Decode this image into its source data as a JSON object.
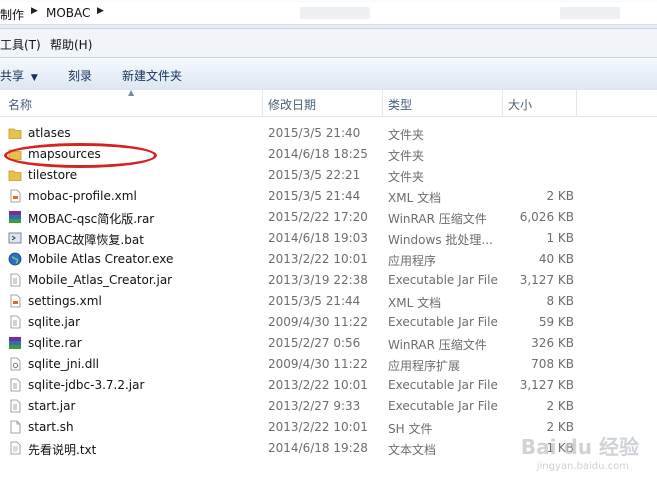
{
  "address": {
    "crumbs": [
      "制作",
      "MOBAC"
    ]
  },
  "menu": [
    "工具(T)",
    "帮助(H)"
  ],
  "toolbar": {
    "share": "共享",
    "burn": "刻录",
    "new_folder": "新建文件夹"
  },
  "columns": {
    "name": "名称",
    "modified": "修改日期",
    "type": "类型",
    "size": "大小"
  },
  "files": [
    {
      "name": "atlases",
      "date": "2015/3/5 21:40",
      "type": "文件夹",
      "size": "",
      "icon": "folder-icon"
    },
    {
      "name": "mapsources",
      "date": "2014/6/18 18:25",
      "type": "文件夹",
      "size": "",
      "icon": "folder-icon"
    },
    {
      "name": "tilestore",
      "date": "2015/3/5 22:21",
      "type": "文件夹",
      "size": "",
      "icon": "folder-icon"
    },
    {
      "name": "mobac-profile.xml",
      "date": "2015/3/5 21:44",
      "type": "XML 文档",
      "size": "2 KB",
      "icon": "xml-file-icon"
    },
    {
      "name": "MOBAC-qsc简化版.rar",
      "date": "2015/2/22 17:20",
      "type": "WinRAR 压缩文件",
      "size": "6,026 KB",
      "icon": "rar-file-icon"
    },
    {
      "name": "MOBAC故障恢复.bat",
      "date": "2014/6/18 19:03",
      "type": "Windows 批处理...",
      "size": "1 KB",
      "icon": "bat-file-icon"
    },
    {
      "name": "Mobile Atlas Creator.exe",
      "date": "2013/2/22 10:01",
      "type": "应用程序",
      "size": "40 KB",
      "icon": "globe-exe-icon"
    },
    {
      "name": "Mobile_Atlas_Creator.jar",
      "date": "2013/3/19 22:38",
      "type": "Executable Jar File",
      "size": "3,127 KB",
      "icon": "jar-file-icon"
    },
    {
      "name": "settings.xml",
      "date": "2015/3/5 21:44",
      "type": "XML 文档",
      "size": "8 KB",
      "icon": "xml-file-icon"
    },
    {
      "name": "sqlite.jar",
      "date": "2009/4/30 11:22",
      "type": "Executable Jar File",
      "size": "59 KB",
      "icon": "jar-file-icon"
    },
    {
      "name": "sqlite.rar",
      "date": "2015/2/27 0:56",
      "type": "WinRAR 压缩文件",
      "size": "326 KB",
      "icon": "rar-file-icon"
    },
    {
      "name": "sqlite_jni.dll",
      "date": "2009/4/30 11:22",
      "type": "应用程序扩展",
      "size": "708 KB",
      "icon": "dll-file-icon"
    },
    {
      "name": "sqlite-jdbc-3.7.2.jar",
      "date": "2013/2/22 10:01",
      "type": "Executable Jar File",
      "size": "3,127 KB",
      "icon": "jar-file-icon"
    },
    {
      "name": "start.jar",
      "date": "2013/2/27 9:33",
      "type": "Executable Jar File",
      "size": "2 KB",
      "icon": "jar-file-icon"
    },
    {
      "name": "start.sh",
      "date": "2013/2/22 10:01",
      "type": "SH 文件",
      "size": "2 KB",
      "icon": "file-icon"
    },
    {
      "name": "先看说明.txt",
      "date": "2014/6/18 19:28",
      "type": "文本文档",
      "size": "1 KB",
      "icon": "txt-file-icon"
    }
  ],
  "watermark": {
    "brand": "Bai du 经验",
    "url": "jingyan.baidu.com"
  }
}
